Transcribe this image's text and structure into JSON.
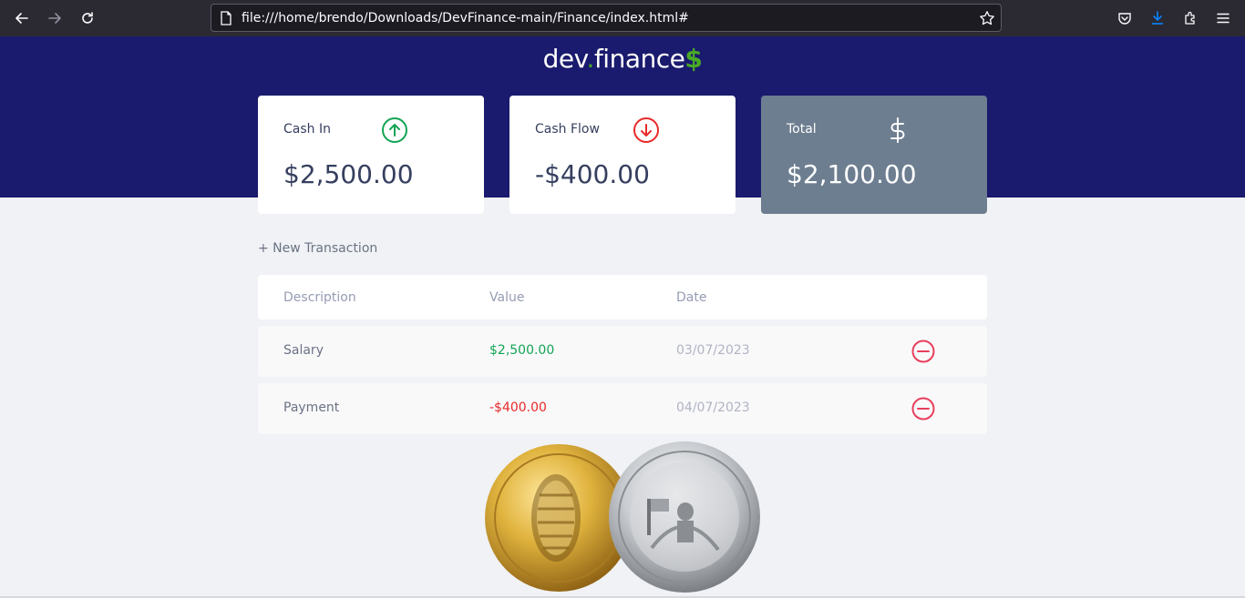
{
  "browser": {
    "url": "file:///home/brendo/Downloads/DevFinance-main/Finance/index.html#"
  },
  "app": {
    "logo_main": "dev",
    "logo_dot": ".",
    "logo_finance": "finance",
    "logo_dollar": "$"
  },
  "cards": {
    "income": {
      "label": "Cash In",
      "value": "$2,500.00",
      "icon": "arrow-up-circle-icon"
    },
    "expense": {
      "label": "Cash Flow",
      "value": "-$400.00",
      "icon": "arrow-down-circle-icon"
    },
    "total": {
      "label": "Total",
      "value": "$2,100.00",
      "icon": "dollar-sign-icon"
    }
  },
  "new_transaction_label": "+ New Transaction",
  "table": {
    "headers": [
      "Description",
      "Value",
      "Date"
    ],
    "rows": [
      {
        "description": "Salary",
        "value": "$2,500.00",
        "date": "03/07/2023",
        "type": "income"
      },
      {
        "description": "Payment",
        "value": "-$400.00",
        "date": "04/07/2023",
        "type": "expense"
      }
    ]
  },
  "colors": {
    "header_bg": "#1a1a6e",
    "income": "#12a454",
    "expense": "#e92929",
    "total_card": "#6d7e90",
    "accent_green": "#49aa26"
  }
}
